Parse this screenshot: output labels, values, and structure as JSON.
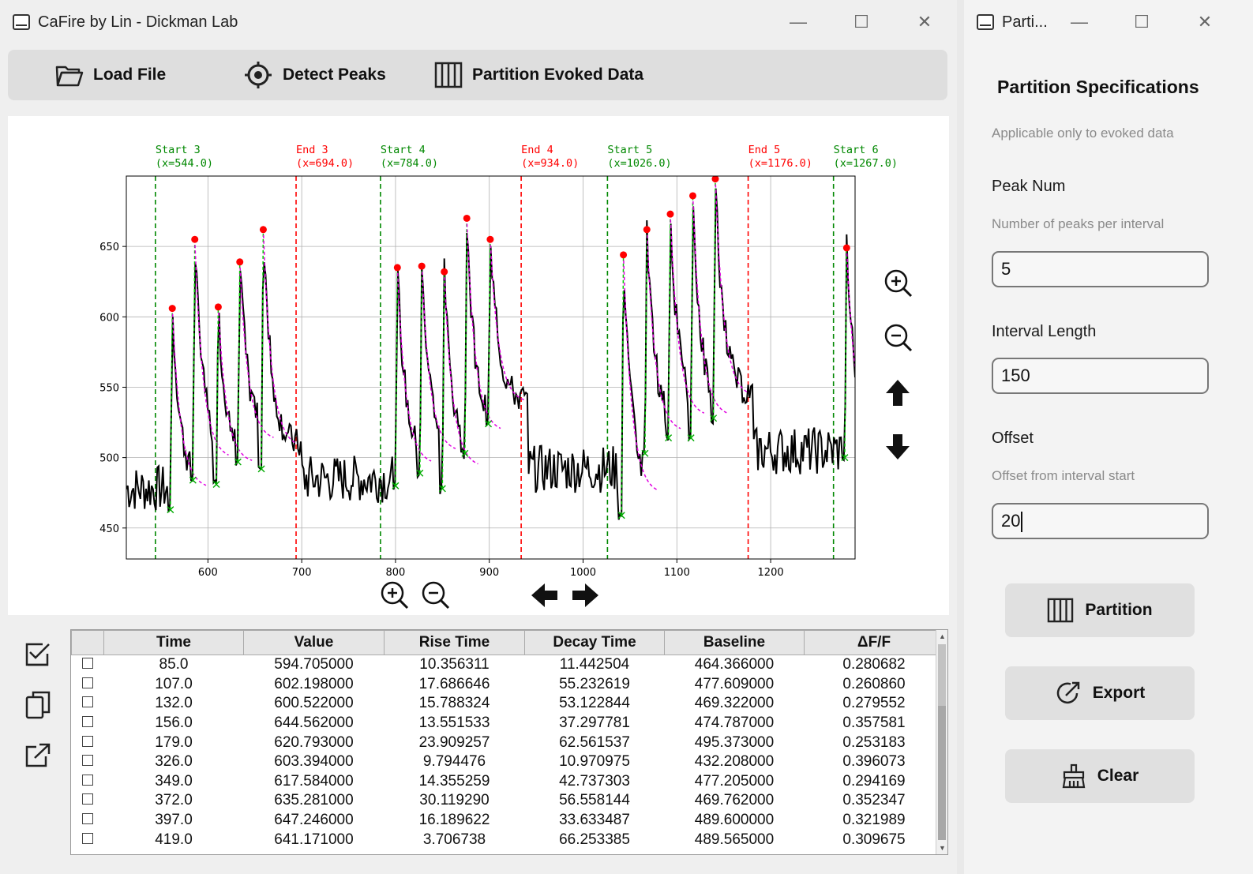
{
  "main_window": {
    "title": "CaFire by Lin - Dickman Lab",
    "controls": {
      "minimize": "—",
      "maximize": "☐",
      "close": "✕"
    }
  },
  "toolbar": {
    "load_file": "Load File",
    "detect_peaks": "Detect Peaks",
    "partition_evoked": "Partition Evoked Data"
  },
  "icons": {
    "load_file": "folder-icon",
    "detect_peaks": "crosshair-icon",
    "partition": "partition-bars-icon",
    "zoom_in": "zoom-in-icon",
    "zoom_out": "zoom-out-icon",
    "pan_up": "arrow-up-icon",
    "pan_down": "arrow-down-icon",
    "pan_left": "arrow-left-icon",
    "pan_right": "arrow-right-icon",
    "select_all": "checklist-icon",
    "copy": "copy-icon",
    "external": "open-external-icon",
    "export": "export-icon",
    "clear": "broom-icon"
  },
  "chart_data": {
    "type": "line",
    "xlim": [
      513,
      1290
    ],
    "ylim": [
      428,
      700
    ],
    "xticks": [
      600,
      700,
      800,
      900,
      1000,
      1100,
      1200
    ],
    "yticks": [
      450,
      500,
      550,
      600,
      650
    ],
    "grid": true,
    "colors": {
      "trace": "#000000",
      "fit": "#e000e0",
      "rise": "#00cc00",
      "peak": "#ff0000",
      "trough": "#00aa00",
      "start_line": "#008800",
      "end_line": "#ff0000"
    },
    "markers": [
      {
        "kind": "start",
        "label": "Start 3",
        "sublabel": "(x=544.0)",
        "x": 544
      },
      {
        "kind": "end",
        "label": "End 3",
        "sublabel": "(x=694.0)",
        "x": 694
      },
      {
        "kind": "start",
        "label": "Start 4",
        "sublabel": "(x=784.0)",
        "x": 784
      },
      {
        "kind": "end",
        "label": "End 4",
        "sublabel": "(x=934.0)",
        "x": 934
      },
      {
        "kind": "start",
        "label": "Start 5",
        "sublabel": "(x=1026.0)",
        "x": 1026
      },
      {
        "kind": "end",
        "label": "End 5",
        "sublabel": "(x=1176.0)",
        "x": 1176
      },
      {
        "kind": "start",
        "label": "Start 6",
        "sublabel": "(x=1267.0)",
        "x": 1267
      }
    ],
    "peaks": [
      {
        "x": 562,
        "y": 606,
        "trough": 463
      },
      {
        "x": 586,
        "y": 655,
        "trough": 484
      },
      {
        "x": 611,
        "y": 607,
        "trough": 481
      },
      {
        "x": 634,
        "y": 639,
        "trough": 497
      },
      {
        "x": 659,
        "y": 662,
        "trough": 492
      },
      {
        "x": 802,
        "y": 635,
        "trough": 480
      },
      {
        "x": 828,
        "y": 636,
        "trough": 489
      },
      {
        "x": 852,
        "y": 632,
        "trough": 478
      },
      {
        "x": 876,
        "y": 670,
        "trough": 503
      },
      {
        "x": 901,
        "y": 655,
        "trough": 524
      },
      {
        "x": 1043,
        "y": 644,
        "trough": 459
      },
      {
        "x": 1068,
        "y": 662,
        "trough": 503
      },
      {
        "x": 1093,
        "y": 673,
        "trough": 514
      },
      {
        "x": 1117,
        "y": 686,
        "trough": 514
      },
      {
        "x": 1141,
        "y": 698,
        "trough": 528
      },
      {
        "x": 1281,
        "y": 649,
        "trough": 500
      }
    ],
    "baseline_segments": [
      {
        "x0": 513,
        "x1": 560,
        "level": 478
      },
      {
        "x0": 665,
        "x1": 800,
        "level": 485
      },
      {
        "x0": 910,
        "x1": 1040,
        "level": 492
      },
      {
        "x0": 1160,
        "x1": 1275,
        "level": 505
      }
    ]
  },
  "table": {
    "columns": [
      "",
      "Time",
      "Value",
      "Rise Time",
      "Decay Time",
      "Baseline",
      "ΔF/F"
    ],
    "rows": [
      [
        "85.0",
        "594.705000",
        "10.356311",
        "11.442504",
        "464.366000",
        "0.280682"
      ],
      [
        "107.0",
        "602.198000",
        "17.686646",
        "55.232619",
        "477.609000",
        "0.260860"
      ],
      [
        "132.0",
        "600.522000",
        "15.788324",
        "53.122844",
        "469.322000",
        "0.279552"
      ],
      [
        "156.0",
        "644.562000",
        "13.551533",
        "37.297781",
        "474.787000",
        "0.357581"
      ],
      [
        "179.0",
        "620.793000",
        "23.909257",
        "62.561537",
        "495.373000",
        "0.253183"
      ],
      [
        "326.0",
        "603.394000",
        "9.794476",
        "10.970975",
        "432.208000",
        "0.396073"
      ],
      [
        "349.0",
        "617.584000",
        "14.355259",
        "42.737303",
        "477.205000",
        "0.294169"
      ],
      [
        "372.0",
        "635.281000",
        "30.119290",
        "56.558144",
        "469.762000",
        "0.352347"
      ],
      [
        "397.0",
        "647.246000",
        "16.189622",
        "33.633487",
        "489.600000",
        "0.321989"
      ],
      [
        "419.0",
        "641.171000",
        "3.706738",
        "66.253385",
        "489.565000",
        "0.309675"
      ]
    ]
  },
  "side_window": {
    "title": "Parti...",
    "heading": "Partition Specifications",
    "subtitle": "Applicable only to evoked data",
    "peak_num_label": "Peak Num",
    "peak_num_help": "Number of peaks per interval",
    "peak_num_value": "5",
    "interval_label": "Interval Length",
    "interval_value": "150",
    "offset_label": "Offset",
    "offset_help": "Offset from interval start",
    "offset_value": "20",
    "partition_button": "Partition",
    "export_button": "Export",
    "clear_button": "Clear"
  }
}
